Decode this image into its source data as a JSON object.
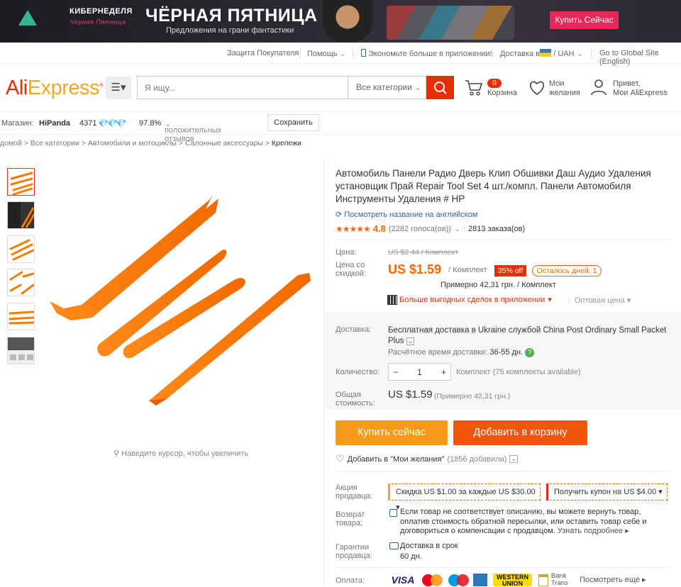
{
  "banner": {
    "cyber_title": "КИБЕРНЕДЕЛЯ",
    "cyber_sub": "Черная Пятница",
    "title": "ЧЁРНАЯ ПЯТНИЦА",
    "subtitle": "Предложения на грани фантастики",
    "buy_label": "Купить Сейчас"
  },
  "topnav": {
    "protection": "Защита Покупателя",
    "help": "Помощь",
    "app": "Экономьте больше в приложении!",
    "delivery": "Доставка в",
    "currency": "UAH",
    "global": "Go to Global Site (English)"
  },
  "header": {
    "logo_main": "Ali",
    "logo_rest": "Express",
    "search_placeholder": "Я ищу...",
    "categories": "Все категории",
    "cart_count": "0",
    "cart_label": "Корзина",
    "wish_l1": "Мои",
    "wish_l2": "желания",
    "account_l1": "Привет,",
    "account_l2": "Мои AliExpress"
  },
  "store": {
    "label": "Магазин:",
    "name": "HiPanda",
    "score": "4371",
    "percent": "97.8%",
    "feedback": "положительных отзывов",
    "save": "Сохранить"
  },
  "breadcrumbs": [
    "домой",
    "Все категории",
    "Автомобили и мотоциклы",
    "Салонные аксессуары",
    "Крепежи"
  ],
  "gallery": {
    "zoom_hint": "Наведите курсор, чтобы увеличить"
  },
  "product": {
    "title": "Автомобиль Панели Радио Дверь Клип Обшивки Даш Аудио Удаления установщик Прай Repair Tool Set 4 шт./компл. Панели Автомобиля Инструменты Удаления # HP",
    "english_link": "Посмотреть название на английском",
    "rating": "4.8",
    "votes": "(2282 голоса(ов))",
    "orders": "2813 заказа(ов)",
    "price_label": "Цена:",
    "old_price": "US $2.44 / Комплект",
    "discount_label": "Цена со скидкой:",
    "price": "US $1.59",
    "unit": "/ Комплект",
    "off": "35% off",
    "days_left": "Осталось дней: 1",
    "approx": "Примерно 42,31 грн. / Комплект",
    "app_deal": "Больше выгодных сделок в приложении",
    "wholesale": "Оптовая цена",
    "shipping_label": "Доставка:",
    "shipping": "Бесплатная доставка в Ukraine службой China Post Ordinary Small Packet Plus",
    "eta_label": "Расчётное время доставки:",
    "eta": "36-55 дн.",
    "qty_label": "Количество:",
    "qty": "1",
    "qty_minus": "−",
    "qty_plus": "+",
    "qty_avail": "Комплект (75 комплекты available)",
    "total_label": "Общая стоимость:",
    "total": "US $1.59",
    "total_approx": "(Примерно 42,31 грн.)",
    "buy_now": "Купить сейчас",
    "add_cart": "Добавить в корзину",
    "wish": "Добавить в \"Мои желания\"",
    "wish_count": "(1856 добавили)",
    "promo_label": "Акция продавца:",
    "coupon1": "Скидка US $1.00 за каждые US $30.00",
    "coupon2": "Получить купон на US $4.00",
    "return_label": "Возврат товара:",
    "return_text": "Если товар не соответствует описанию, вы можете вернуть товар, оплатив стоимость обратной пересылки, или оставить товар себе и договориться о компенсации с продавцом.",
    "return_more": "Узнать подробнее",
    "guarantee_label": "Гарантии продавца:",
    "guarantee1": "Доставка в срок",
    "guarantee2": "60 дн.",
    "payment_label": "Оплата:",
    "payments": [
      "VISA",
      "MasterCard",
      "Maestro",
      "AmEx",
      "WESTERN UNION",
      "Bank Transfer"
    ],
    "see_all": "Посмотреть ещё"
  },
  "colors": {
    "brand": "#e62e04",
    "orange": "#f60",
    "buy": "#f79a1a",
    "cart": "#f0560d"
  }
}
